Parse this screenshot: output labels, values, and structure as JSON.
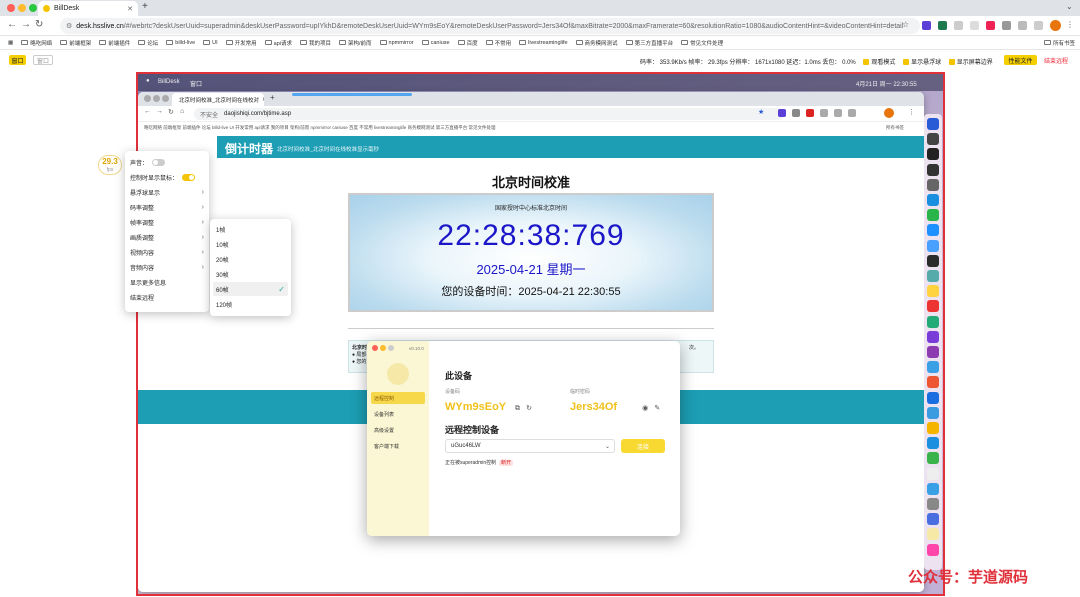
{
  "outer": {
    "tab_title": "BillDesk",
    "url_host": "desk.hsslive.cn",
    "url_rest": "/#/webrtc?deskUserUuid=superadmin&deskUserPassword=upIYkhD&remoteDeskUserUuid=WYm9sEoY&remoteDeskUserPassword=Jers34Of&maxBitrate=2000&maxFramerate=60&resolutionRatio=1080&audioContentHint=&videoContentHint=detail",
    "bookmarks": [
      "略吃网络",
      "前端框架",
      "前端插件",
      "论坛",
      "billd-live",
      "UI",
      "开发常用",
      "api请求",
      "我的项目",
      "架构/前而",
      "npmmirror",
      "caniuse",
      "百度",
      "不常用",
      "livestreaminglife",
      "商务模网测试",
      "第三方直播平台",
      "常见文件处理"
    ],
    "bookmarks_right": "所有书签"
  },
  "status": {
    "window_btn": "窗口",
    "window_btn2": "窗口",
    "stats": "码率： 353.9Kb/s   帧率： 29.3fps   分辨率： 1671x1080   延迟：1.0ms   丢包： 0.0%",
    "opt1": "观看模式",
    "opt2": "显示悬浮球",
    "opt3": "显示屏幕边界",
    "perf_btn": "性能文件",
    "end_btn": "结束远程"
  },
  "remote": {
    "menubar_app": "BillDesk",
    "menubar_item": "窗口",
    "menubar_right": "4月21日 周一  22:30:55",
    "inner_tab": "北京时间校准_北京时间在线校对",
    "inner_url_warn": "不安全",
    "inner_url": "daojishiqi.com/bjtime.asp",
    "inner_book_right": "所有书签",
    "inner_bookmarks": "略吃网络   前端框架   前端插件   论坛   billd-live   UI   开发常用   api请求   我的项目   架构/前而   npmmirror   caniuse   百度   不常用   livestreaminglife   商务模网测试   第三方直播平台   常见文件处理",
    "countdown_title": "倒计时器",
    "countdown_sub": "北京时间校准_北京时间在线校准显示毫秒",
    "bj_title": "北京时间校准",
    "clock_head": "国家授时中心标准北京时间",
    "clock_time": "22:28:38:769",
    "clock_date": "2025-04-21 星期一",
    "clock_local": "您的设备时间：2025-04-21 22:30:55",
    "note_line1": "北京时",
    "note_line2": "● 局部手",
    "note_line3": "● 您的系",
    "note_tail": "次。"
  },
  "overlay": {
    "fps_value": "29.3",
    "fps_unit": "fps",
    "menu": [
      {
        "label": "声音：",
        "toggle": "off"
      },
      {
        "label": "控制时显示鼠标：",
        "toggle": "on"
      },
      {
        "label": "悬浮球显示",
        "arrow": true
      },
      {
        "label": "码率调整",
        "arrow": true
      },
      {
        "label": "帧率调整",
        "arrow": true
      },
      {
        "label": "画质调整",
        "arrow": true
      },
      {
        "label": "视频内容",
        "arrow": true
      },
      {
        "label": "音频内容",
        "arrow": true
      },
      {
        "label": "显示更多信息"
      },
      {
        "label": "结束远程"
      }
    ],
    "submenu": [
      {
        "label": "1帧"
      },
      {
        "label": "10帧"
      },
      {
        "label": "20帧"
      },
      {
        "label": "30帧"
      },
      {
        "label": "60帧",
        "selected": true
      },
      {
        "label": "120帧"
      }
    ]
  },
  "app": {
    "version": "v0.10.0",
    "side_items": [
      {
        "label": "远程控制",
        "active": true
      },
      {
        "label": "设备列表"
      },
      {
        "label": "高级设置"
      },
      {
        "label": "客户端下载"
      }
    ],
    "device_title": "此设备",
    "code_label": "设备码",
    "code_value": "WYm9sEoY",
    "pwd_label": "临时密码",
    "pwd_value": "Jers34Of",
    "rc_title": "远程控制设备",
    "rc_value": "uGuc46LW",
    "rc_button": "连接",
    "ctrl_note": "正在被superadmin控制",
    "ctrl_tag": "断开"
  },
  "watermark": "公众号：芋道源码",
  "colors": {
    "accent": "#f5c400",
    "teal": "#1d9eb4",
    "clock_blue": "#1b17c8",
    "frame_red": "#e0303a"
  }
}
